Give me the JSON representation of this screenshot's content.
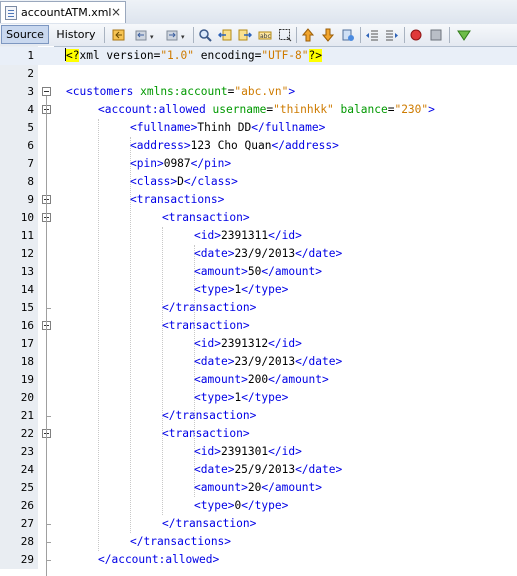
{
  "tab": {
    "title": "accountATM.xml",
    "close": "×"
  },
  "toolbar": {
    "source_label": "Source",
    "history_label": "History",
    "icons": [
      "last-edit-icon",
      "back-icon",
      "forward-icon",
      "find-icon",
      "find-previous-icon",
      "find-next-icon",
      "toggle-highlight-icon",
      "toggle-rectangular-selection-icon",
      "previous-bookmark-icon",
      "next-bookmark-icon",
      "toggle-bookmark-icon",
      "shift-left-icon",
      "shift-right-icon",
      "start-macro-icon",
      "stop-macro-icon",
      "check-xml-icon"
    ]
  },
  "lines": [
    {
      "n": "1",
      "indent": 0,
      "html": "pi",
      "text": "<?xml version=\"1.0\" encoding=\"UTF-8\"?>"
    },
    {
      "n": "2",
      "indent": 0,
      "text": ""
    },
    {
      "n": "3",
      "indent": 0,
      "text": "<customers xmlns:account=\"abc.vn\">"
    },
    {
      "n": "4",
      "indent": 1,
      "text": "<account:allowed username=\"thinhkk\" balance=\"230\">"
    },
    {
      "n": "5",
      "indent": 2,
      "text": "<fullname>Thinh DD</fullname>"
    },
    {
      "n": "6",
      "indent": 2,
      "text": "<address>123 Cho Quan</address>"
    },
    {
      "n": "7",
      "indent": 2,
      "text": "<pin>0987</pin>"
    },
    {
      "n": "8",
      "indent": 2,
      "text": "<class>D</class>"
    },
    {
      "n": "9",
      "indent": 2,
      "text": "<transactions>"
    },
    {
      "n": "10",
      "indent": 3,
      "text": "<transaction>"
    },
    {
      "n": "11",
      "indent": 4,
      "text": "<id>2391311</id>"
    },
    {
      "n": "12",
      "indent": 4,
      "text": "<date>23/9/2013</date>"
    },
    {
      "n": "13",
      "indent": 4,
      "text": "<amount>50</amount>"
    },
    {
      "n": "14",
      "indent": 4,
      "text": "<type>1</type>"
    },
    {
      "n": "15",
      "indent": 3,
      "text": "</transaction>"
    },
    {
      "n": "16",
      "indent": 3,
      "text": "<transaction>"
    },
    {
      "n": "17",
      "indent": 4,
      "text": "<id>2391312</id>"
    },
    {
      "n": "18",
      "indent": 4,
      "text": "<date>23/9/2013</date>"
    },
    {
      "n": "19",
      "indent": 4,
      "text": "<amount>200</amount>"
    },
    {
      "n": "20",
      "indent": 4,
      "text": "<type>1</type>"
    },
    {
      "n": "21",
      "indent": 3,
      "text": "</transaction>"
    },
    {
      "n": "22",
      "indent": 3,
      "text": "<transaction>"
    },
    {
      "n": "23",
      "indent": 4,
      "text": "<id>2391301</id>"
    },
    {
      "n": "24",
      "indent": 4,
      "text": "<date>25/9/2013</date>"
    },
    {
      "n": "25",
      "indent": 4,
      "text": "<amount>20</amount>"
    },
    {
      "n": "26",
      "indent": 4,
      "text": "<type>0</type>"
    },
    {
      "n": "27",
      "indent": 3,
      "text": "</transaction>"
    },
    {
      "n": "28",
      "indent": 2,
      "text": "</transactions>"
    },
    {
      "n": "29",
      "indent": 1,
      "text": "</account:allowed>"
    }
  ],
  "folds": [
    "3",
    "4",
    "9",
    "10",
    "16",
    "22"
  ],
  "colors": {
    "tag": "#0000e6",
    "attr": "#009900",
    "value": "#ce7b00",
    "pi_highlight": "#ffff00",
    "current_line": "#e9eff8"
  }
}
